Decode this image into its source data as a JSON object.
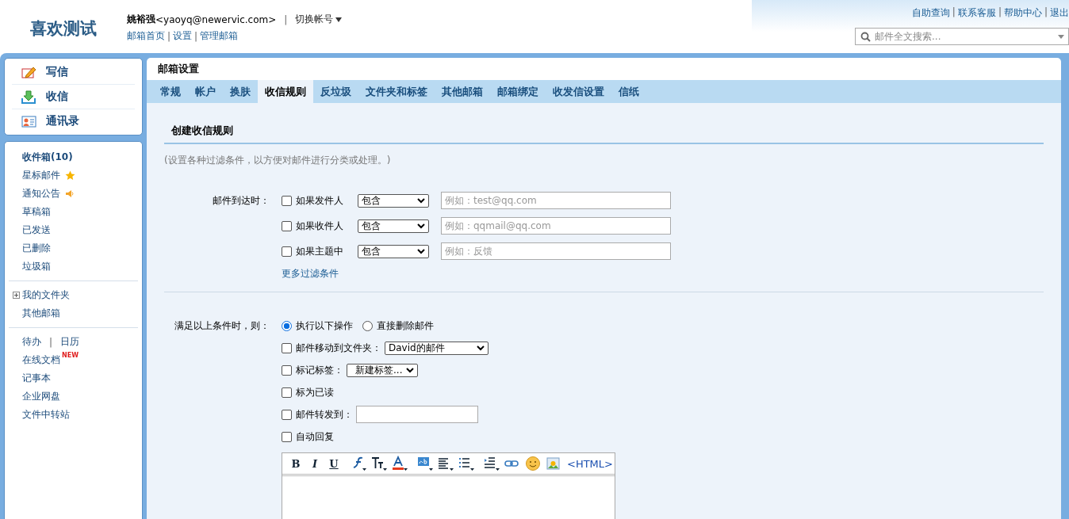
{
  "header": {
    "logo": "喜欢测试",
    "user_name": "姚裕强",
    "user_email": "<yaoyq@newervic.com>",
    "separator": "|",
    "switch_account": "切换帐号",
    "links": [
      "邮箱首页",
      "设置",
      "管理邮箱"
    ],
    "top_links": [
      "自助查询",
      "联系客服",
      "帮助中心",
      "退出"
    ],
    "search": {
      "placeholder": "邮件全文搜索..."
    }
  },
  "sidebar": {
    "actions": [
      {
        "kind": "compose",
        "label": "写信"
      },
      {
        "kind": "receive",
        "label": "收信"
      },
      {
        "kind": "contacts",
        "label": "通讯录"
      }
    ],
    "folders": [
      {
        "label": "收件箱(10)",
        "unread": true,
        "kind": "plain"
      },
      {
        "label": "星标邮件",
        "unread": false,
        "kind": "starred"
      },
      {
        "label": "通知公告",
        "unread": false,
        "kind": "notice"
      },
      {
        "label": "草稿箱",
        "unread": false,
        "kind": "plain"
      },
      {
        "label": "已发送",
        "unread": false,
        "kind": "plain"
      },
      {
        "label": "已删除",
        "unread": false,
        "kind": "plain"
      },
      {
        "label": "垃圾箱",
        "unread": false,
        "kind": "plain"
      }
    ],
    "groups": [
      {
        "label": "我的文件夹",
        "expanded": false
      },
      {
        "label": "其他邮箱"
      }
    ],
    "tools": [
      {
        "kind": "pair",
        "labels": [
          "待办",
          "日历"
        ],
        "separator": "|"
      },
      {
        "kind": "badged",
        "label": "在线文档",
        "badge": "NEW"
      },
      {
        "kind": "plain",
        "label": "记事本"
      },
      {
        "kind": "plain",
        "label": "企业网盘"
      },
      {
        "kind": "plain",
        "label": "文件中转站"
      }
    ]
  },
  "main": {
    "title": "邮箱设置",
    "tabs": [
      {
        "label": "常规",
        "selected": false
      },
      {
        "label": "帐户",
        "selected": false
      },
      {
        "label": "换肤",
        "selected": false
      },
      {
        "label": "收信规则",
        "selected": true
      },
      {
        "label": "反垃圾",
        "selected": false
      },
      {
        "label": "文件夹和标签",
        "selected": false
      },
      {
        "label": "其他邮箱",
        "selected": false
      },
      {
        "label": "邮箱绑定",
        "selected": false
      },
      {
        "label": "收发信设置",
        "selected": false
      },
      {
        "label": "信纸",
        "selected": false
      }
    ],
    "section_title": "创建收信规则",
    "hint": "(设置各种过滤条件，以方便对邮件进行分类或处理。)",
    "conditions_label": "邮件到达时：",
    "conditions": [
      {
        "label": "如果发件人",
        "checked": false,
        "operator": "包含",
        "placeholder": "例如：test@qq.com"
      },
      {
        "label": "如果收件人",
        "checked": false,
        "operator": "包含",
        "placeholder": "例如：qqmail@qq.com"
      },
      {
        "label": "如果主题中",
        "checked": false,
        "operator": "包含",
        "placeholder": "例如：反馈"
      }
    ],
    "more_conditions": "更多过滤条件",
    "actions_label": "满足以上条件时，则：",
    "modes": [
      {
        "label": "执行以下操作",
        "selected": true
      },
      {
        "label": "直接删除邮件",
        "selected": false
      }
    ],
    "actions": [
      {
        "kind": "select",
        "label": "邮件移动到文件夹：",
        "checked": false,
        "value": "David的邮件"
      },
      {
        "kind": "select",
        "label": "标记标签：",
        "checked": false,
        "value": "新建标签..."
      },
      {
        "kind": "plain",
        "label": "标为已读",
        "checked": false
      },
      {
        "kind": "input",
        "label": "邮件转发到：",
        "checked": false
      },
      {
        "kind": "plain",
        "label": "自动回复",
        "checked": false
      }
    ],
    "editor": {
      "format_buttons": [
        "B",
        "I",
        "U"
      ],
      "html_button": "<HTML>"
    }
  }
}
